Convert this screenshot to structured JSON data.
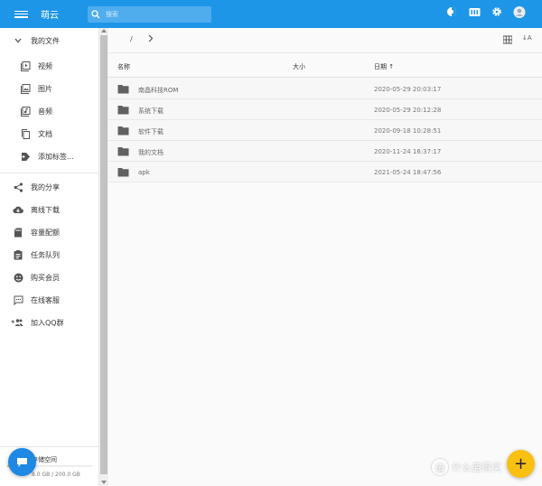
{
  "header": {
    "title": "萌云",
    "search_placeholder": "搜索",
    "icons": [
      "theme-icon",
      "media-icon",
      "settings-icon",
      "account-icon"
    ]
  },
  "sidebar": {
    "my_files": "我的文件",
    "sub_items": [
      {
        "label": "视频",
        "icon": "video-icon"
      },
      {
        "label": "图片",
        "icon": "image-icon"
      },
      {
        "label": "音频",
        "icon": "audio-icon"
      },
      {
        "label": "文档",
        "icon": "document-icon"
      },
      {
        "label": "添加标签...",
        "icon": "tag-add-icon"
      }
    ],
    "items": [
      {
        "label": "我的分享",
        "icon": "share-icon"
      },
      {
        "label": "离线下载",
        "icon": "cloud-download-icon"
      },
      {
        "label": "容量配额",
        "icon": "quota-icon"
      },
      {
        "label": "任务队列",
        "icon": "task-queue-icon"
      },
      {
        "label": "购买会员",
        "icon": "vip-icon"
      },
      {
        "label": "在线客服",
        "icon": "support-icon"
      },
      {
        "label": "加入QQ群",
        "icon": "group-add-icon"
      }
    ],
    "storage": {
      "title": "存储空间",
      "value": "8.0 GB / 200.0 GB",
      "used_fraction": 0.04
    }
  },
  "toolbar": {
    "path_sep": "/",
    "sort_label": "↓A"
  },
  "table": {
    "columns": {
      "name": "名称",
      "size": "大小",
      "date": "日期 ↑"
    },
    "rows": [
      {
        "name": "南晶科技ROM",
        "size": "",
        "date": "2020-05-29 20:03:17"
      },
      {
        "name": "系统下载",
        "size": "",
        "date": "2020-05-29 20:12:28"
      },
      {
        "name": "软件下载",
        "size": "",
        "date": "2020-09-18 10:28:51"
      },
      {
        "name": "我的文档",
        "size": "",
        "date": "2020-11-24 16:37:17"
      },
      {
        "name": "apk",
        "size": "",
        "date": "2021-05-24 18:47:56"
      }
    ]
  },
  "fab": {
    "add_symbol": "+"
  },
  "watermark": {
    "text": "什么值得买",
    "logo": "值"
  },
  "colors": {
    "primary": "#1e96e8",
    "accent": "#f9c012",
    "folder": "#616161"
  }
}
